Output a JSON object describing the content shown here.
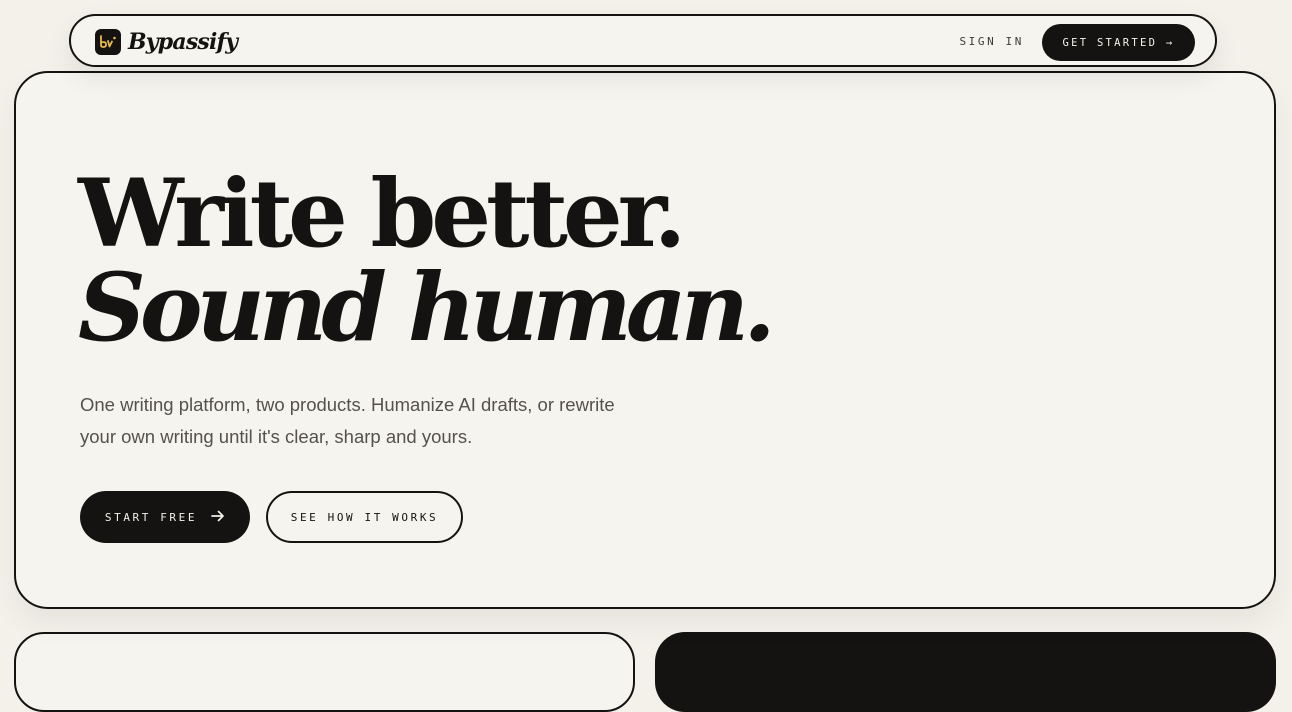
{
  "nav": {
    "brand_name": "Bypassify",
    "signin_label": "SIGN IN",
    "cta_label": "GET STARTED →"
  },
  "hero": {
    "headline_line1": "Write better.",
    "headline_line2": "Sound human.",
    "subcopy_line1": "One writing platform, two products. Humanize AI drafts, or rewrite",
    "subcopy_line2": "your own writing until it's clear, sharp and yours.",
    "primary_button_label": "START FREE",
    "secondary_button_label": "SEE HOW IT WORKS"
  },
  "icons": {
    "brand_logo": "bypassify-logo-icon",
    "primary_button_icon": "arrow-right-icon"
  },
  "colors": {
    "page_background": "#f3f1ea",
    "ink": "#141311",
    "logo_accent": "#e9b949",
    "muted_text": "#55524c"
  }
}
